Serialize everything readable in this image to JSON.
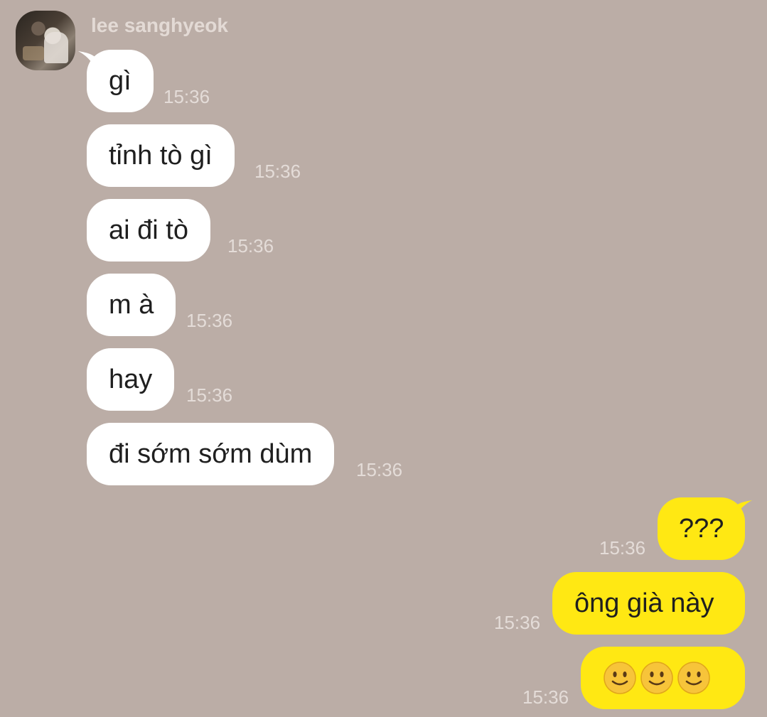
{
  "chat": {
    "sender_name": "lee sanghyeok",
    "incoming": [
      {
        "text": "gì",
        "time": "15:36"
      },
      {
        "text": "tỉnh tò gì",
        "time": "15:36"
      },
      {
        "text": "ai đi tò",
        "time": "15:36"
      },
      {
        "text": "m à",
        "time": "15:36"
      },
      {
        "text": "hay",
        "time": "15:36"
      },
      {
        "text": "đi sớm sớm dùm",
        "time": "15:36"
      }
    ],
    "outgoing": [
      {
        "text": "???",
        "time": "15:36"
      },
      {
        "text": "ông già này",
        "time": "15:36"
      },
      {
        "emojis": [
          "slightly-smiling-face-icon",
          "slightly-smiling-face-icon",
          "slightly-smiling-face-icon"
        ],
        "time": "15:36"
      }
    ]
  },
  "colors": {
    "background": "#bbada6",
    "incoming_bubble": "#ffffff",
    "outgoing_bubble": "#ffe813",
    "timestamp": "#e4dcd8"
  }
}
